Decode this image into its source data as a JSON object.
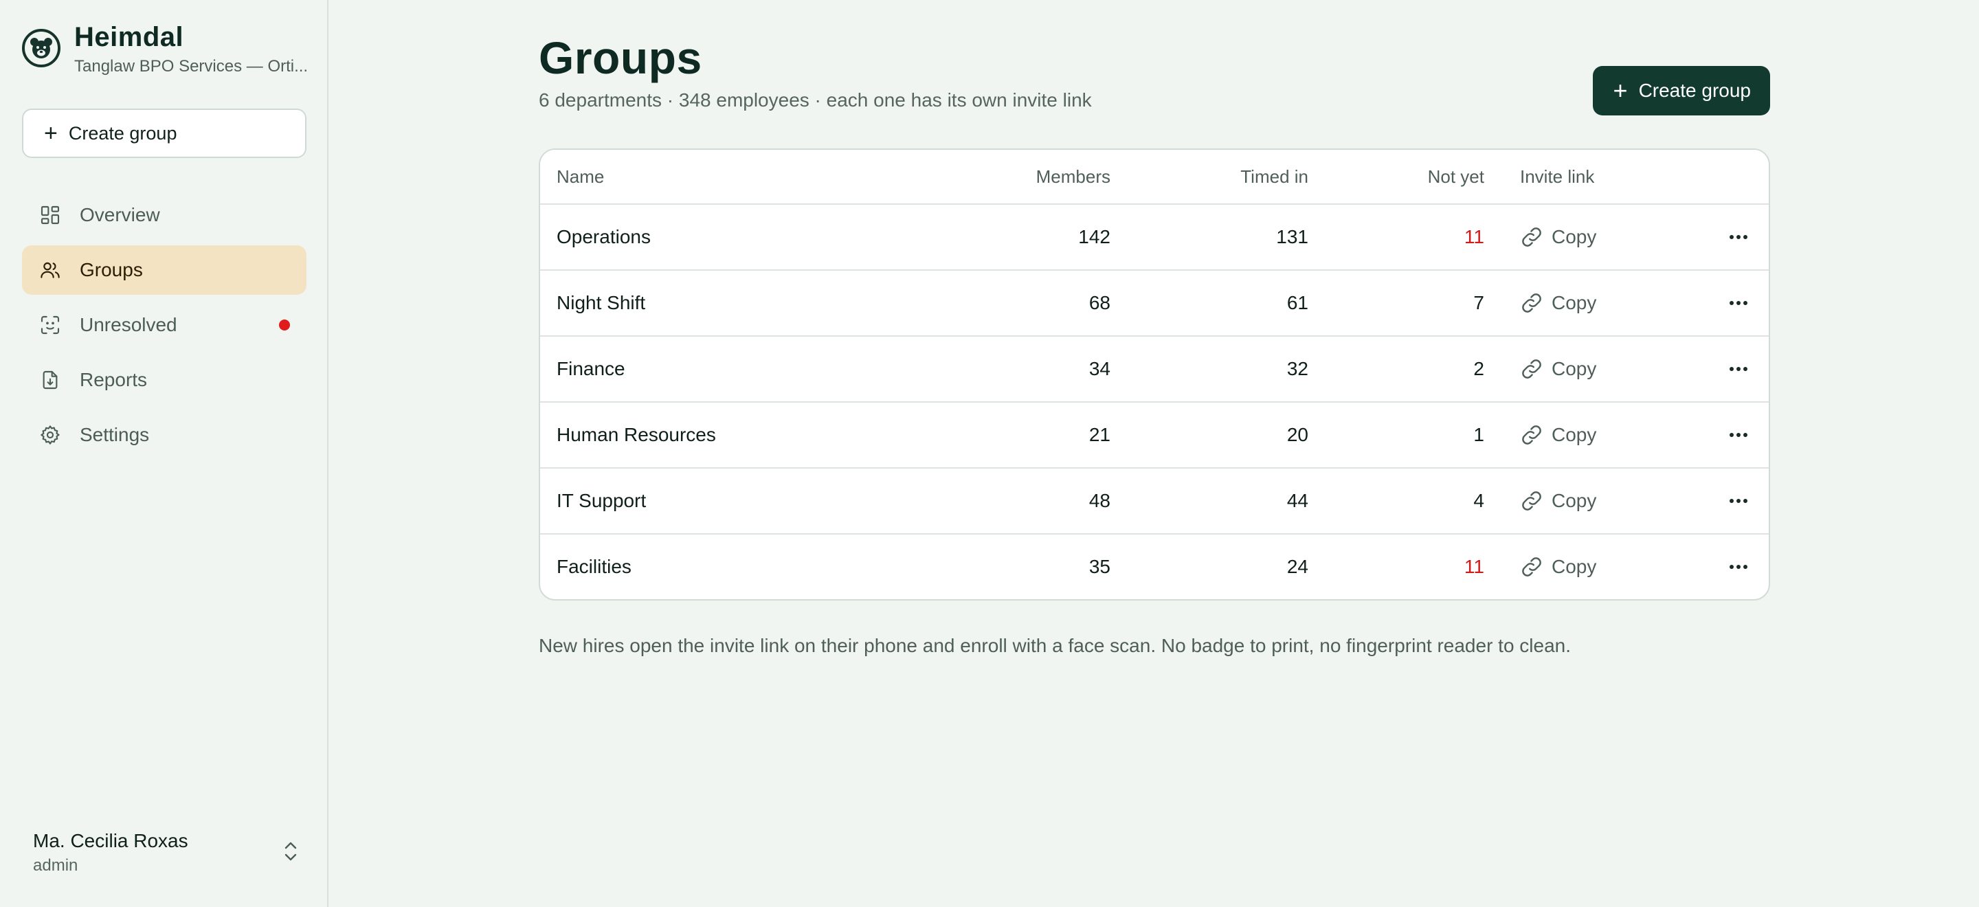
{
  "brand": {
    "name": "Heimdal",
    "org": "Tanglaw BPO Services — Orti..."
  },
  "sidebar": {
    "create_label": "Create group",
    "items": [
      {
        "label": "Overview",
        "icon": "dashboard-icon",
        "active": false
      },
      {
        "label": "Groups",
        "icon": "users-icon",
        "active": true
      },
      {
        "label": "Unresolved",
        "icon": "face-scan-icon",
        "active": false,
        "alert_dot": true
      },
      {
        "label": "Reports",
        "icon": "file-download-icon",
        "active": false
      },
      {
        "label": "Settings",
        "icon": "gear-icon",
        "active": false
      }
    ],
    "user": {
      "name": "Ma. Cecilia Roxas",
      "role": "admin"
    }
  },
  "page": {
    "title": "Groups",
    "subtitle": "6 departments · 348 employees · each one has its own invite link",
    "create_button": "Create group",
    "footnote": "New hires open the invite link on their phone and enroll with a face scan. No badge to print, no fingerprint reader to clean."
  },
  "table": {
    "columns": [
      "Name",
      "Members",
      "Timed in",
      "Not yet",
      "Invite link"
    ],
    "copy_label": "Copy",
    "rows": [
      {
        "name": "Operations",
        "members": "142",
        "timed_in": "131",
        "not_yet": "11",
        "alert": true
      },
      {
        "name": "Night Shift",
        "members": "68",
        "timed_in": "61",
        "not_yet": "7",
        "alert": false
      },
      {
        "name": "Finance",
        "members": "34",
        "timed_in": "32",
        "not_yet": "2",
        "alert": false
      },
      {
        "name": "Human Resources",
        "members": "21",
        "timed_in": "20",
        "not_yet": "1",
        "alert": false
      },
      {
        "name": "IT Support",
        "members": "48",
        "timed_in": "44",
        "not_yet": "4",
        "alert": false
      },
      {
        "name": "Facilities",
        "members": "35",
        "timed_in": "24",
        "not_yet": "11",
        "alert": true
      }
    ]
  },
  "colors": {
    "primary": "#123a2e",
    "active_nav": "#f3e3c2",
    "alert": "#d11a1a",
    "background": "#f1f5f1"
  }
}
